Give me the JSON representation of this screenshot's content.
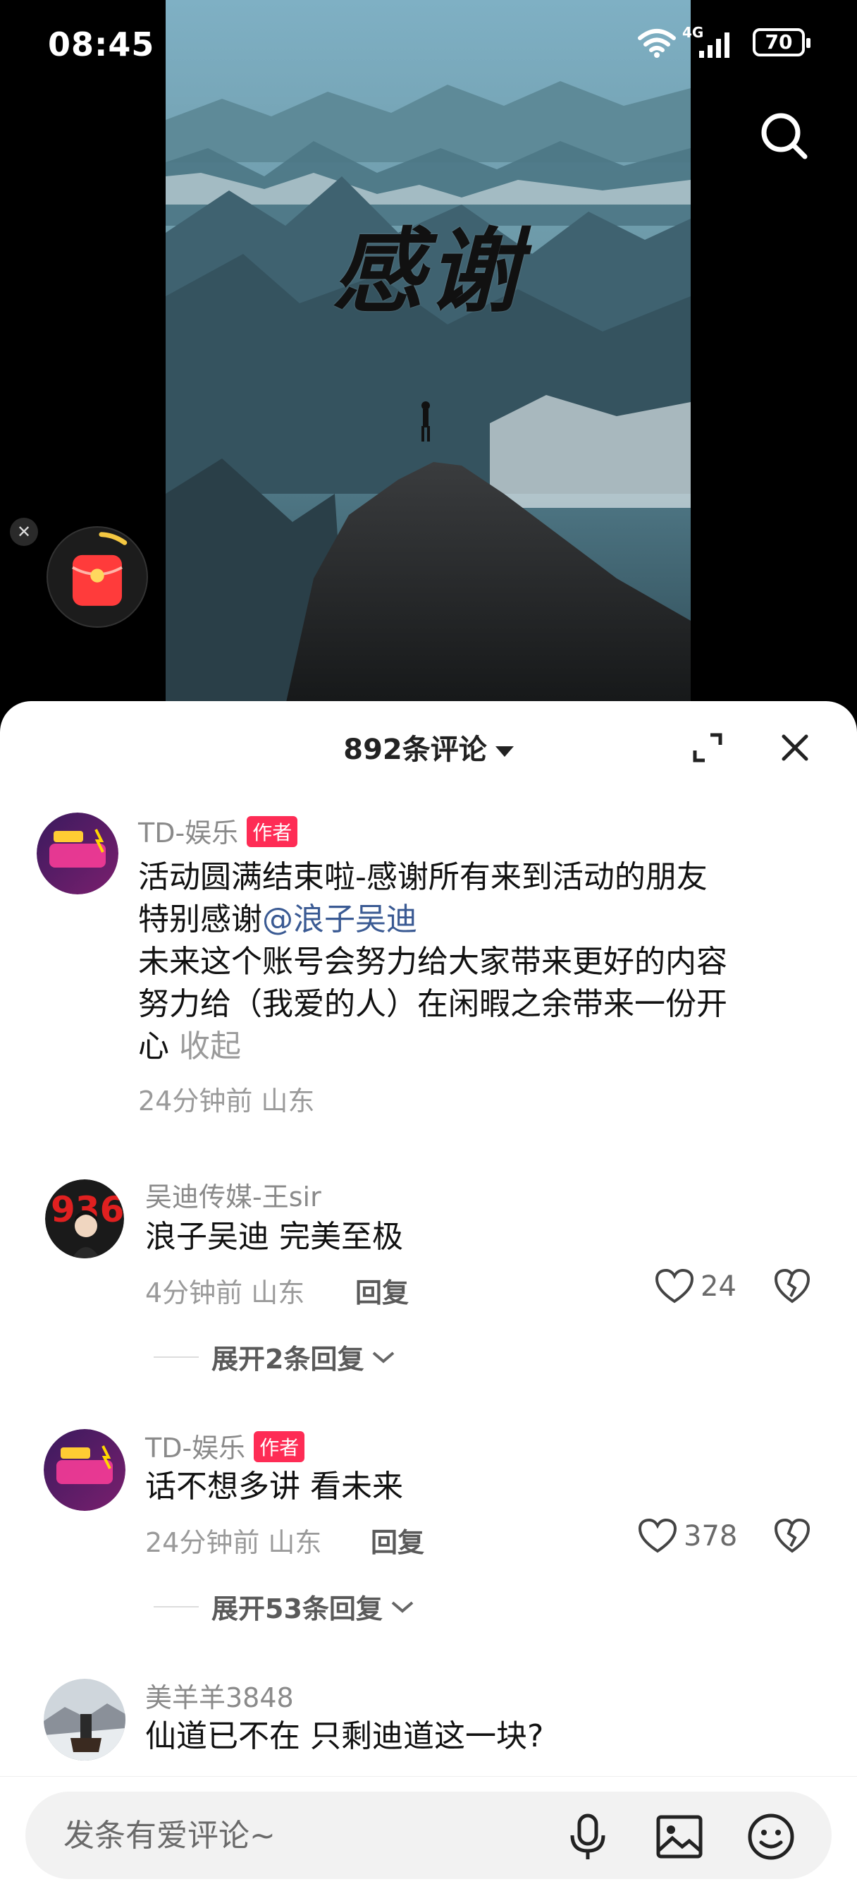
{
  "status_bar": {
    "time": "08:45",
    "network": "4G",
    "battery": "70"
  },
  "video": {
    "title_text": "感谢"
  },
  "sheet": {
    "title": "892条评论"
  },
  "comments": [
    {
      "username": "TD-娱乐",
      "author_badge": "作者",
      "text_line1": "活动圆满结束啦-感谢所有来到活动的朋友",
      "text_line2_prefix": "特别感谢",
      "mention": "@浪子吴迪",
      "text_line3": "未来这个账号会努力给大家带来更好的内容",
      "text_line4": "努力给（我爱的人）在闲暇之余带来一份开",
      "text_line5": "心",
      "collapse_label": "收起",
      "meta": "24分钟前 山东"
    },
    {
      "username": "吴迪传媒-王sir",
      "text": "浪子吴迪 完美至极",
      "meta": "4分钟前 山东",
      "reply_label": "回复",
      "likes": "24",
      "expand_label": "展开2条回复"
    },
    {
      "username": "TD-娱乐",
      "author_badge": "作者",
      "text": "话不想多讲 看未来",
      "meta": "24分钟前 山东",
      "reply_label": "回复",
      "likes": "378",
      "expand_label": "展开53条回复"
    },
    {
      "username": "美羊羊3848",
      "text": "仙道已不在  只剩迪道这一块?"
    }
  ],
  "input": {
    "placeholder": "发条有爱评论~"
  },
  "icons": {
    "search": "search-icon",
    "expand": "expand-icon",
    "close": "close-icon",
    "like": "heart-icon",
    "dislike": "broken-heart-icon",
    "mic": "microphone-icon",
    "image": "image-icon",
    "emoji": "emoji-icon"
  },
  "colors": {
    "author_badge": "#fe2c55",
    "mention": "#3a5a93",
    "sheet_bg": "#ffffff"
  }
}
